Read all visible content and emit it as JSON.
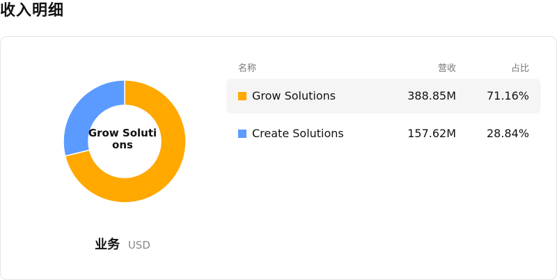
{
  "page": {
    "title": "收入明细"
  },
  "chart": {
    "center_label": "Grow Solutions",
    "segment_name": "业务",
    "currency": "USD"
  },
  "table": {
    "headers": {
      "name": "名称",
      "revenue": "营收",
      "share": "占比"
    },
    "rows": [
      {
        "name": "Grow Solutions",
        "revenue": "388.85M",
        "share": "71.16%",
        "color": "#FFA800"
      },
      {
        "name": "Create Solutions",
        "revenue": "157.62M",
        "share": "28.84%",
        "color": "#5B9BFF"
      }
    ]
  },
  "chart_data": {
    "type": "pie",
    "categories": [
      "Grow Solutions",
      "Create Solutions"
    ],
    "values": [
      71.16,
      28.84
    ],
    "revenue": [
      "388.85M",
      "157.62M"
    ],
    "colors": [
      "#FFA800",
      "#5B9BFF"
    ]
  }
}
